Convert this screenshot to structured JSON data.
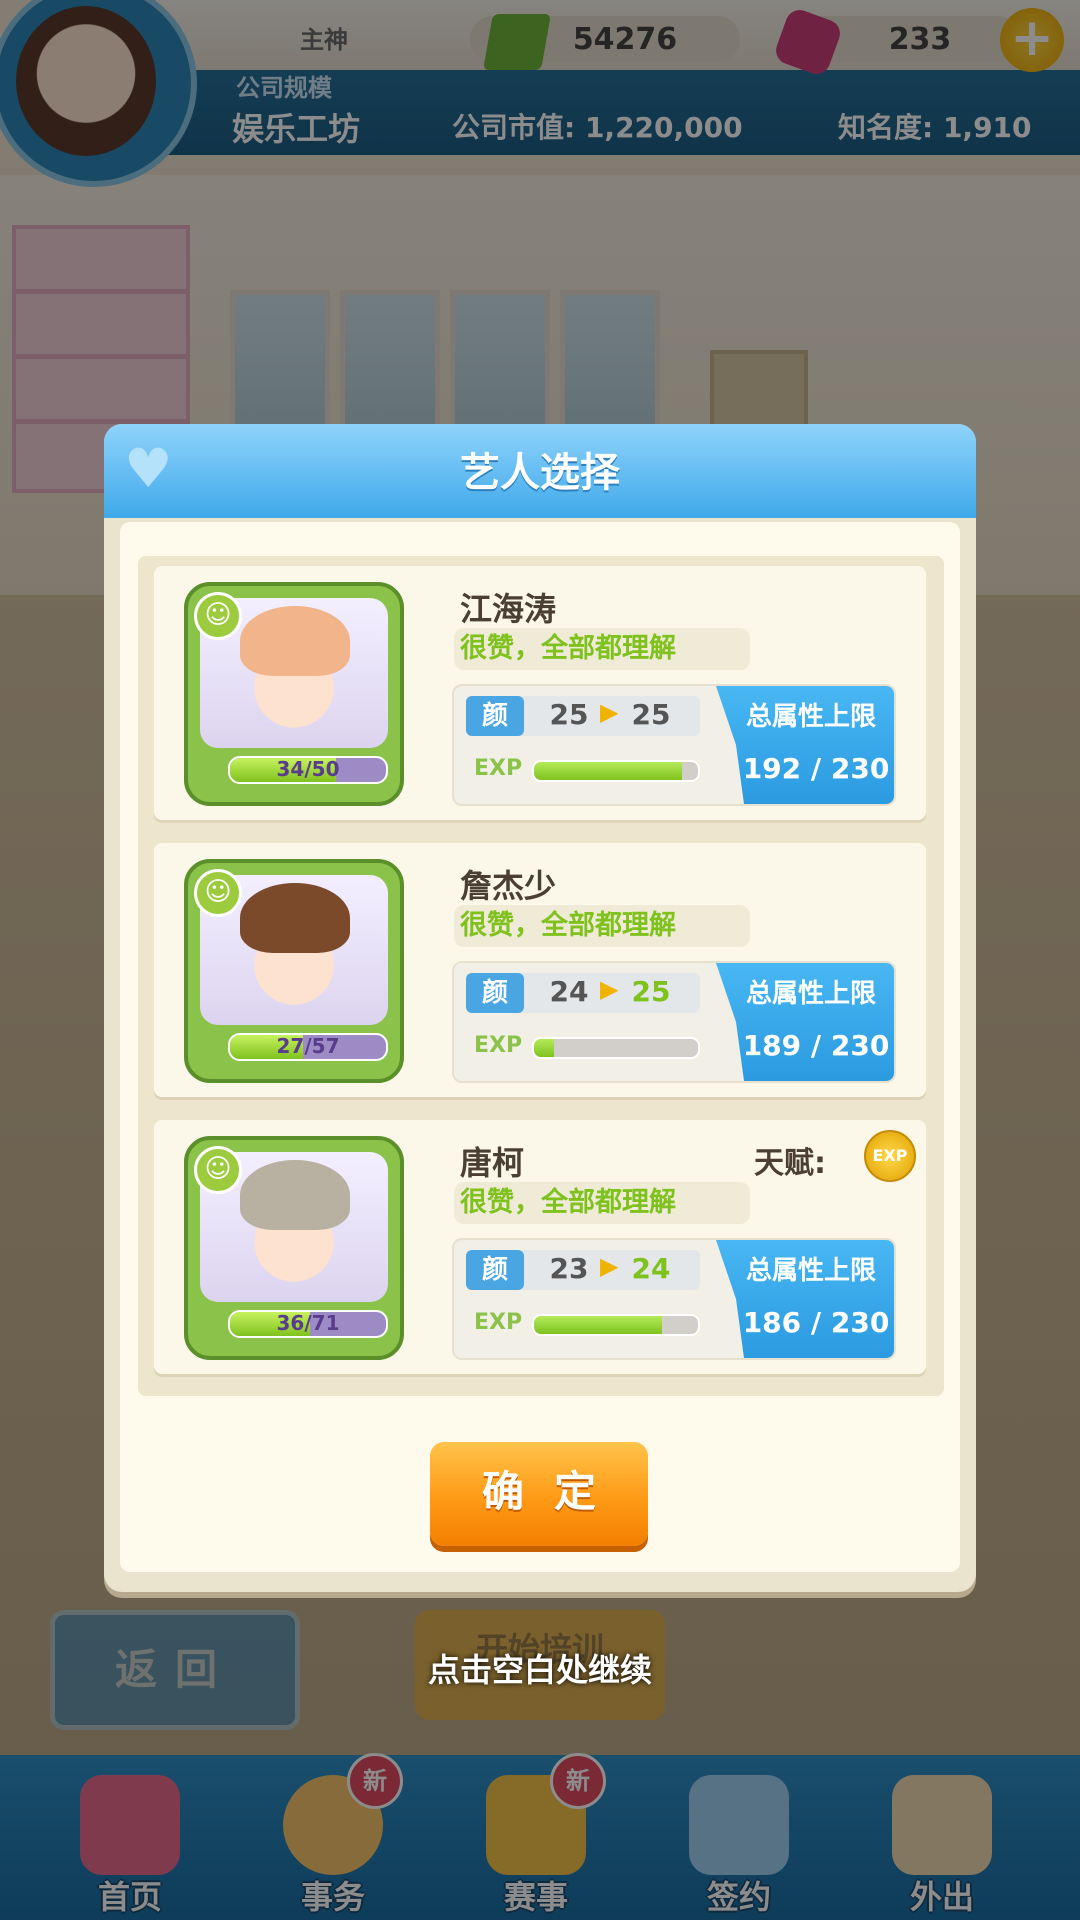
{
  "hud": {
    "player_name": "主神",
    "cash": "54276",
    "gems": "233",
    "company_scale_label": "公司规模",
    "company_type": "娱乐工坊",
    "market_value": "公司市值: 1,220,000",
    "fame": "知名度: 1,910",
    "plus_label": "+"
  },
  "modal": {
    "title": "艺人选择",
    "confirm_label": "确定"
  },
  "artists": [
    {
      "name": "江海涛",
      "comment": "很赞，全部都理解",
      "energy": "34/50",
      "energy_fraction": 0.68,
      "attr_label": "颜",
      "attr_from": "25",
      "attr_to": "25",
      "exp_label": "EXP",
      "exp_fraction": 0.9,
      "total_label": "总属性上限",
      "total_value": "192 / 230",
      "hair_color": "#f2b48a"
    },
    {
      "name": "詹杰少",
      "comment": "很赞，全部都理解",
      "energy": "27/57",
      "energy_fraction": 0.47,
      "attr_label": "颜",
      "attr_from": "24",
      "attr_to": "25",
      "exp_label": "EXP",
      "exp_fraction": 0.12,
      "total_label": "总属性上限",
      "total_value": "189 / 230",
      "hair_color": "#7a4a2a"
    },
    {
      "name": "唐柯",
      "comment": "很赞，全部都理解",
      "energy": "36/71",
      "energy_fraction": 0.51,
      "attr_label": "颜",
      "attr_from": "23",
      "attr_to": "24",
      "exp_label": "EXP",
      "exp_fraction": 0.78,
      "total_label": "总属性上限",
      "total_value": "186 / 230",
      "talent_label": "天赋:",
      "talent_icon_text": "EXP",
      "hair_color": "#b8b0a0"
    }
  ],
  "background": {
    "back_label": "返回",
    "train_label": "开始培训",
    "continue_hint": "点击空白处继续"
  },
  "nav": [
    {
      "label": "首页",
      "badge": ""
    },
    {
      "label": "事务",
      "badge": "新"
    },
    {
      "label": "赛事",
      "badge": "新"
    },
    {
      "label": "签约",
      "badge": ""
    },
    {
      "label": "外出",
      "badge": ""
    }
  ],
  "colors": {
    "accent_blue": "#3fa9ea",
    "accent_green": "#7fc21e",
    "confirm_orange": "#ff9a16",
    "attr_up": "#7fc21e",
    "attr_same": "#555555"
  }
}
